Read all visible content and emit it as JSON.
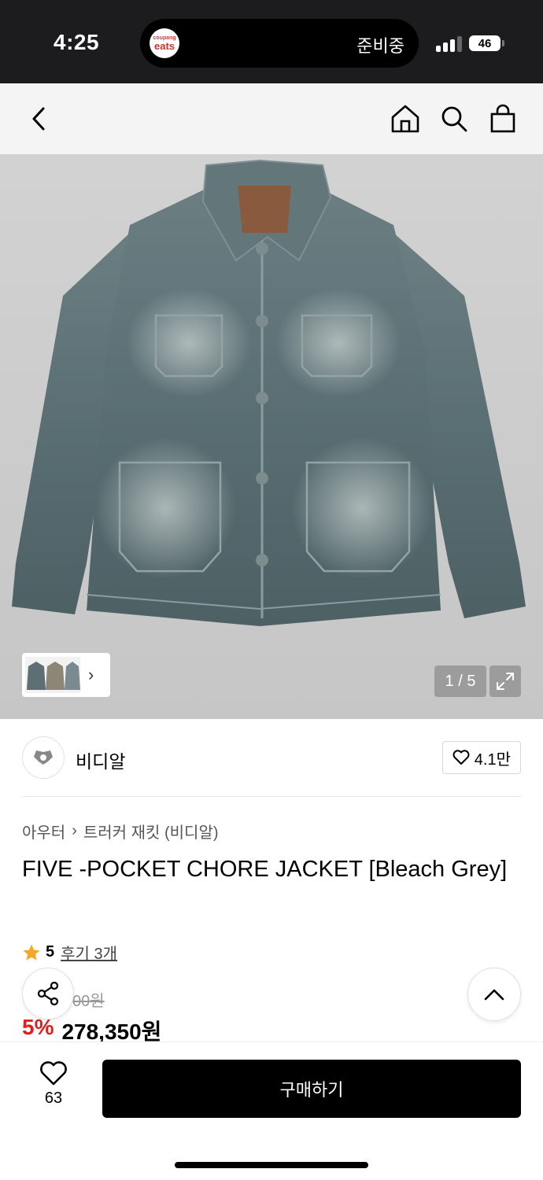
{
  "status_bar": {
    "time": "4:25",
    "island_app_line1": "coupang",
    "island_app_line2": "eats",
    "island_status": "준비중",
    "battery": "46"
  },
  "nav": {
    "back_icon": "chevron-left-icon",
    "home_icon": "home-icon",
    "search_icon": "search-icon",
    "cart_icon": "shopping-bag-icon"
  },
  "gallery": {
    "counter": "1 / 5",
    "thumb_arrow": "›"
  },
  "brand": {
    "name": "비디알",
    "likes": "4.1만"
  },
  "breadcrumb": {
    "category": "아우터",
    "separator": "›",
    "subcategory": "트러커 재킷 (비디알)"
  },
  "product": {
    "title": "FIVE -POCKET CHORE JACKET [Bleach Grey]",
    "rating_score": "5",
    "reviews": "후기 3개",
    "original_price": "00원",
    "discount": "5%",
    "price": "278,350원"
  },
  "bottom_bar": {
    "wish_count": "63",
    "buy_label": "구매하기"
  },
  "colors": {
    "discount_red": "#e02020",
    "star": "#f5a623",
    "denim": "#5f7478"
  }
}
